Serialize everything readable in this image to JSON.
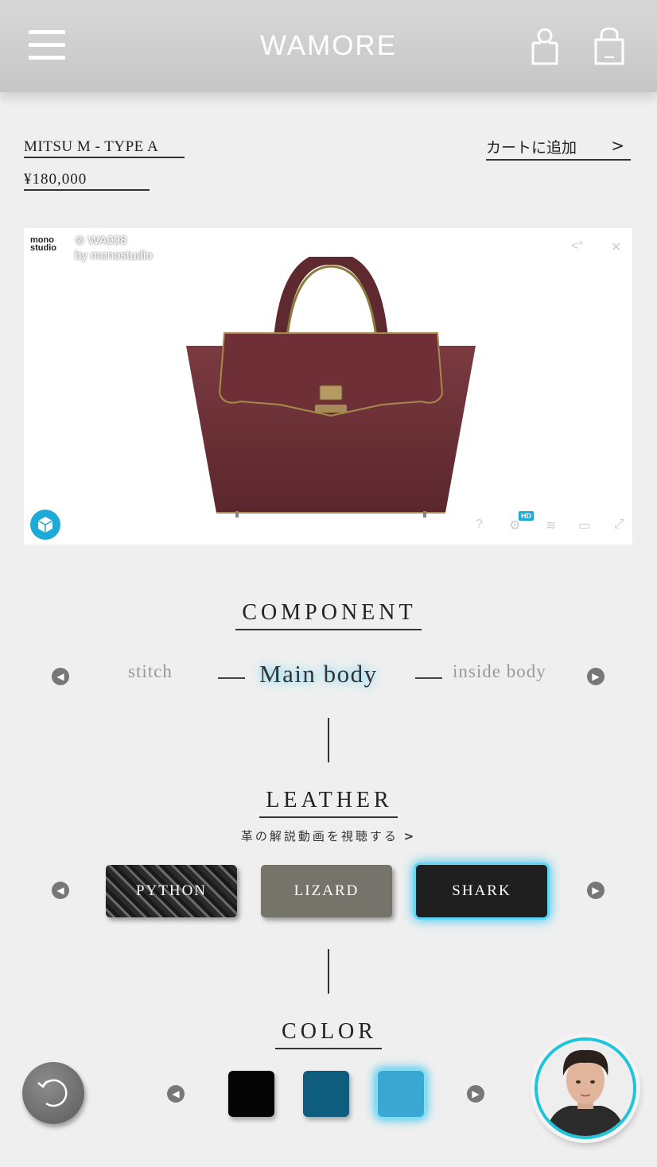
{
  "header": {
    "brand": "WAMORE",
    "menu_icon": "hamburger-icon",
    "account_icon": "user-icon",
    "cart_icon": "shopping-bag-icon"
  },
  "product": {
    "name": "MITSU M - TYPE A",
    "price": "¥180,000",
    "add_to_cart": "カートに追加"
  },
  "viewer": {
    "logo_top": "mono",
    "logo_bottom": "studio",
    "model_id": "WA008",
    "byline": "by monostudio",
    "hd_badge": "HD"
  },
  "component": {
    "title": "COMPONENT",
    "prev": "stitch",
    "current": "Main body",
    "next": "inside body"
  },
  "leather": {
    "title": "LEATHER",
    "video_link": "革の解説動画を視聴する",
    "options": [
      "PYTHON",
      "LIZARD",
      "SHARK"
    ],
    "selected": "SHARK"
  },
  "color": {
    "title": "COLOR",
    "swatches": [
      "#050505",
      "#0e5c7e",
      "#3aa8d2"
    ],
    "selected_index": 2
  },
  "colors": {
    "accent_glow": "#3ec8ee",
    "avatar_ring": "#1ec4dc",
    "bag": "#6a2f35"
  }
}
